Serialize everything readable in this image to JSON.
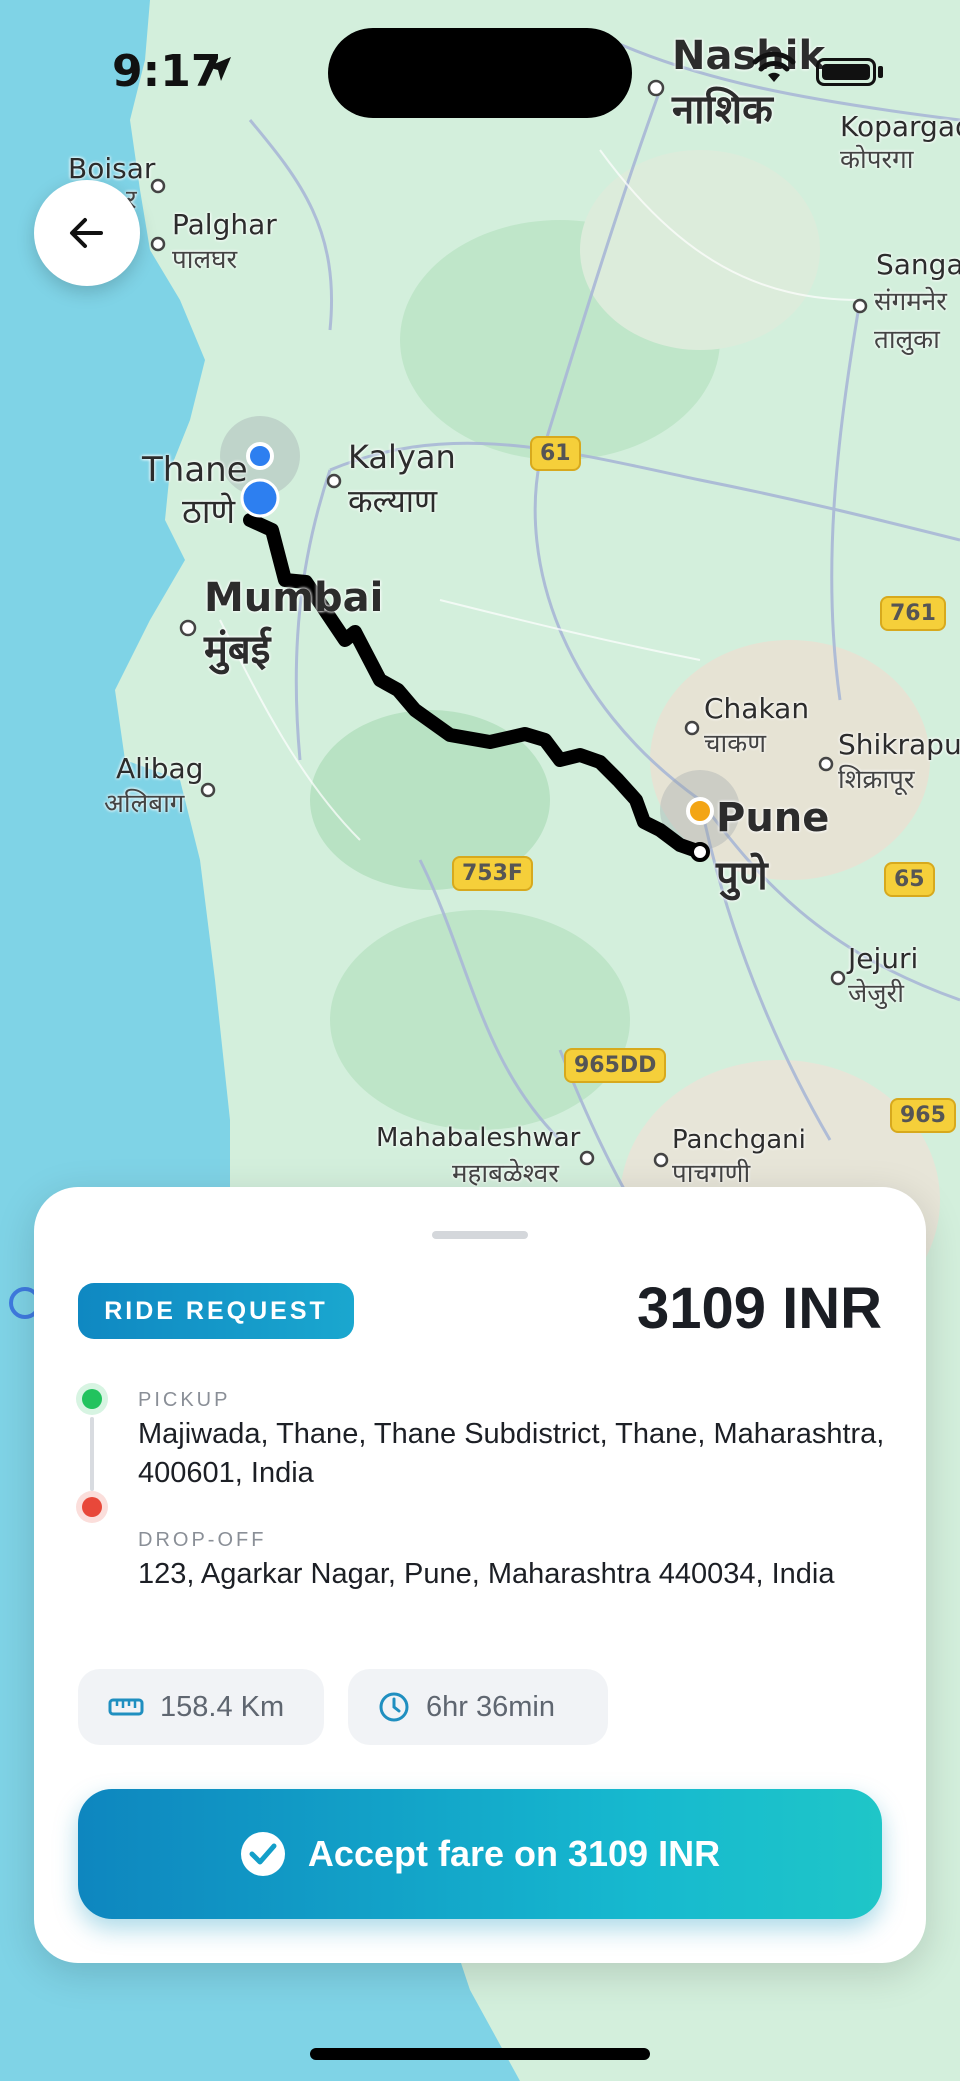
{
  "status_bar": {
    "time": "9:17"
  },
  "map": {
    "labels": [
      {
        "id": "nashik",
        "en": "Nashik",
        "local": "नाशिक"
      },
      {
        "id": "kopargao",
        "en": "Kopargao",
        "local": "कोपरगा"
      },
      {
        "id": "boisar",
        "en": "Boisar",
        "local": "र"
      },
      {
        "id": "palghar",
        "en": "Palghar",
        "local": "पालघर"
      },
      {
        "id": "sangamner",
        "en": "Sangar",
        "local": "संगमनेर"
      },
      {
        "id": "taluka",
        "en": "",
        "local": "तालुका"
      },
      {
        "id": "kalyan",
        "en": "Kalyan",
        "local": "कल्याण"
      },
      {
        "id": "thane",
        "en": "Thane",
        "local": "ठाणे"
      },
      {
        "id": "mumbai",
        "en": "Mumbai",
        "local": "मुंबई"
      },
      {
        "id": "chakan",
        "en": "Chakan",
        "local": "चाकण"
      },
      {
        "id": "shikrapur",
        "en": "Shikrapur",
        "local": "शिक्रापूर"
      },
      {
        "id": "alibag",
        "en": "Alibag",
        "local": "अलिबाग"
      },
      {
        "id": "pune",
        "en": "Pune",
        "local": "पुणे"
      },
      {
        "id": "jejuri",
        "en": "Jejuri",
        "local": "जेजुरी"
      },
      {
        "id": "mahabaleshwar",
        "en": "Mahabaleshwar",
        "local": "महाबळेश्वर"
      },
      {
        "id": "panchgani",
        "en": "Panchgani",
        "local": "पाचगणी"
      }
    ],
    "shields": [
      "61",
      "761",
      "753F",
      "65",
      "965DD",
      "965"
    ],
    "colors": {
      "water": "#7fd3e6",
      "land": "#cfeedd",
      "route": "#000000",
      "origin": "#2d7ff0",
      "destination": "#f3a515"
    }
  },
  "ride": {
    "badge": "RIDE REQUEST",
    "price": "3109 INR",
    "pickup": {
      "label": "PICKUP",
      "address": "Majiwada, Thane, Thane Subdistrict, Thane, Maharashtra, 400601, India"
    },
    "dropoff": {
      "label": "DROP-OFF",
      "address": "123, Agarkar Nagar, Pune, Maharashtra 440034, India"
    },
    "distance": "158.4 Km",
    "duration": "6hr 36min",
    "accept_label": "Accept fare on 3109 INR"
  }
}
